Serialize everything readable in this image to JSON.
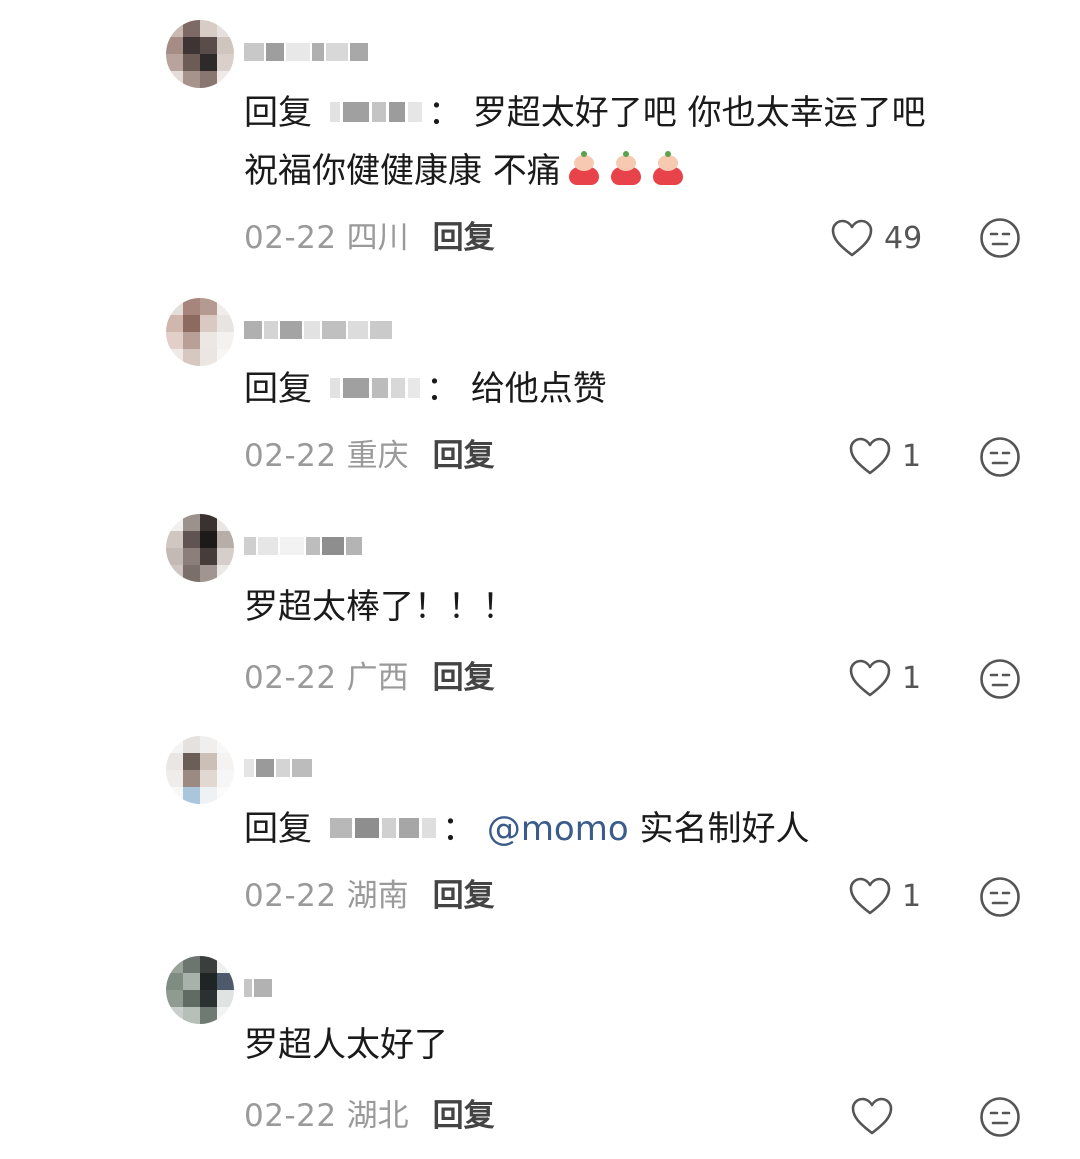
{
  "comments": [
    {
      "prefix": "回复",
      "colon": "：",
      "text_line1": "罗超太好了吧 你也太幸运了吧",
      "text_line2": "祝福你健健康康 不痛",
      "date": "02-22",
      "location": "四川",
      "reply_label": "回复",
      "likes": "49"
    },
    {
      "prefix": "回复",
      "colon": "：",
      "text_line1": "给他点赞",
      "date": "02-22",
      "location": "重庆",
      "reply_label": "回复",
      "likes": "1"
    },
    {
      "text_line1": "罗超太棒了！！！",
      "date": "02-22",
      "location": "广西",
      "reply_label": "回复",
      "likes": "1"
    },
    {
      "prefix": "回复",
      "colon": "：",
      "mention": "@momo",
      "text_line1": "实名制好人",
      "date": "02-22",
      "location": "湖南",
      "reply_label": "回复",
      "likes": "1"
    },
    {
      "text_line1": "罗超人太好了",
      "date": "02-22",
      "location": "湖北",
      "reply_label": "回复",
      "likes": ""
    }
  ],
  "icons": {
    "like": "heart-outline-icon",
    "dislike": "meh-face-icon",
    "emoji": "red-doll-emoji-icon"
  },
  "colors": {
    "text": "#1a1a1a",
    "meta": "#9a9a9a",
    "mention": "#3b5c8a",
    "icon": "#555555"
  }
}
